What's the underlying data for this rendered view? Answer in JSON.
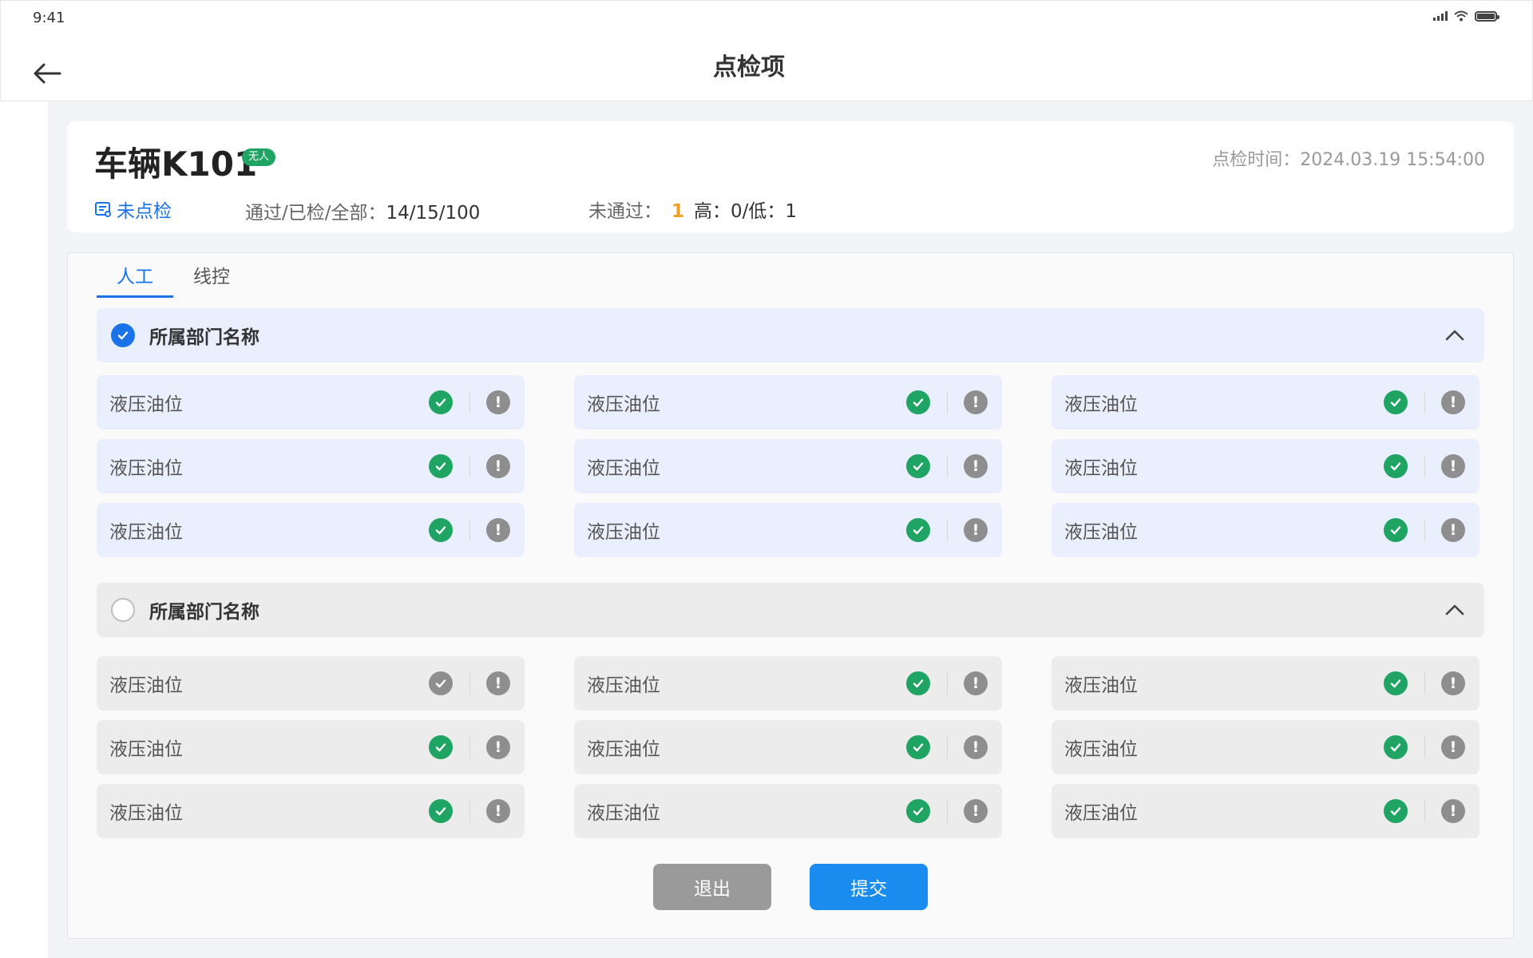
{
  "status_bar": {
    "time": "9:41"
  },
  "header": {
    "title": "点检项"
  },
  "vehicle": {
    "name": "车辆K101",
    "badge": "无人",
    "check_time_label": "点检时间：",
    "check_time": "2024.03.19 15:54:00",
    "status_link": "未点检",
    "stat_label": "通过/已检/全部：",
    "stat_value": "14/15/100",
    "fail_label": "未通过：",
    "fail_count": "1",
    "fail_detail": "高：0/低：1"
  },
  "tabs": [
    {
      "label": "人工",
      "active": true
    },
    {
      "label": "线控",
      "active": false
    }
  ],
  "groups": [
    {
      "title": "所属部门名称",
      "checked": true,
      "items": [
        {
          "label": "液压油位",
          "passed": true
        },
        {
          "label": "液压油位",
          "passed": true
        },
        {
          "label": "液压油位",
          "passed": true
        },
        {
          "label": "液压油位",
          "passed": true
        },
        {
          "label": "液压油位",
          "passed": true
        },
        {
          "label": "液压油位",
          "passed": true
        },
        {
          "label": "液压油位",
          "passed": true
        },
        {
          "label": "液压油位",
          "passed": true
        },
        {
          "label": "液压油位",
          "passed": true
        }
      ]
    },
    {
      "title": "所属部门名称",
      "checked": false,
      "items": [
        {
          "label": "液压油位",
          "passed": false
        },
        {
          "label": "液压油位",
          "passed": true
        },
        {
          "label": "液压油位",
          "passed": true
        },
        {
          "label": "液压油位",
          "passed": true
        },
        {
          "label": "液压油位",
          "passed": true
        },
        {
          "label": "液压油位",
          "passed": true
        },
        {
          "label": "液压油位",
          "passed": true
        },
        {
          "label": "液压油位",
          "passed": true
        },
        {
          "label": "液压油位",
          "passed": true
        }
      ]
    }
  ],
  "actions": {
    "exit_label": "退出",
    "submit_label": "提交"
  },
  "colors": {
    "accent": "#1a73e8",
    "pass": "#1fa463",
    "fail_count": "#f0a020",
    "neutral": "#8e8e8e"
  }
}
